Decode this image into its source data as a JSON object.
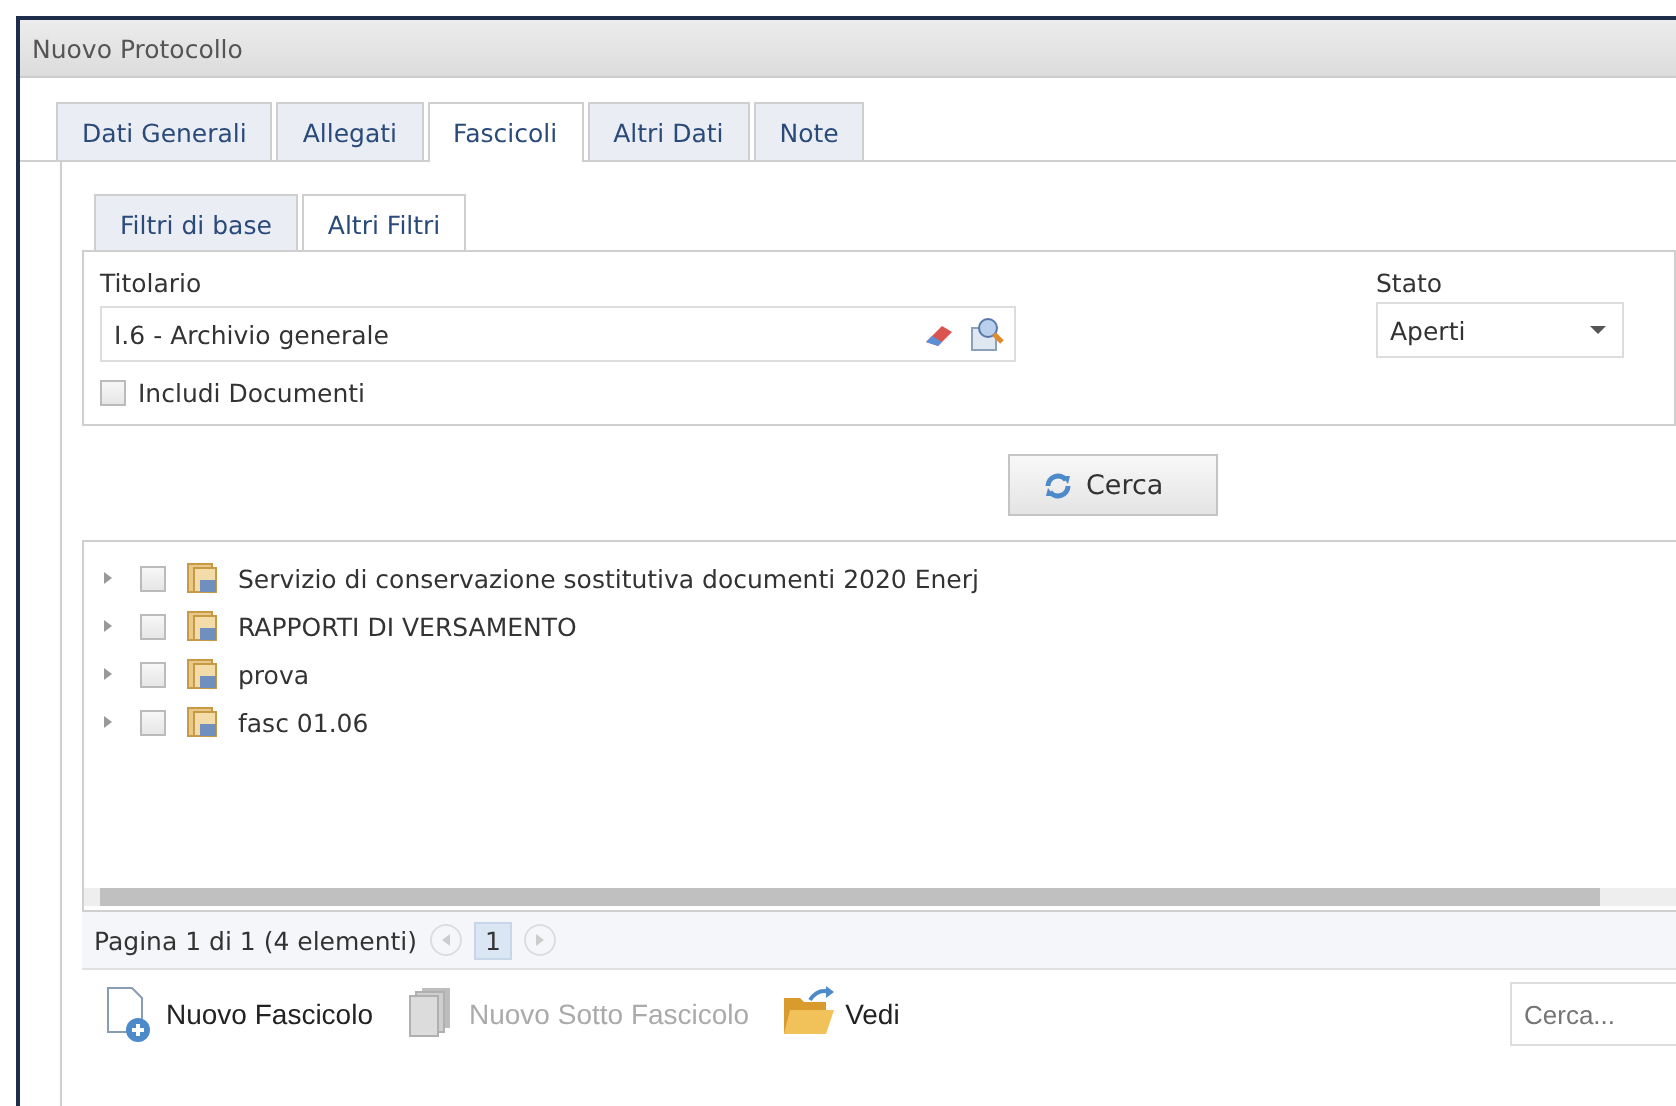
{
  "window": {
    "title": "Nuovo Protocollo"
  },
  "tabs": [
    {
      "label": "Dati Generali",
      "selected": false
    },
    {
      "label": "Allegati",
      "selected": false
    },
    {
      "label": "Fascicoli",
      "selected": true
    },
    {
      "label": "Altri Dati",
      "selected": false
    },
    {
      "label": "Note",
      "selected": false
    }
  ],
  "filter_tabs": [
    {
      "label": "Filtri di base",
      "selected": false
    },
    {
      "label": "Altri Filtri",
      "selected": true
    }
  ],
  "titolario": {
    "label": "Titolario",
    "value": "I.6 - Archivio generale"
  },
  "stato": {
    "label": "Stato",
    "value": "Aperti"
  },
  "include_documents": {
    "label": "Includi Documenti",
    "checked": false
  },
  "search_button": "Cerca",
  "tree": [
    {
      "label": "Servizio di conservazione sostitutiva documenti 2020 Enerj",
      "expanded": false,
      "checked": false
    },
    {
      "label": "RAPPORTI DI VERSAMENTO",
      "expanded": false,
      "checked": false
    },
    {
      "label": "prova",
      "expanded": false,
      "checked": false
    },
    {
      "label": "fasc 01.06",
      "expanded": false,
      "checked": false
    }
  ],
  "pager": {
    "summary": "Pagina 1 di 1 (4 elementi)",
    "pages": [
      {
        "label": "1",
        "selected": true
      }
    ]
  },
  "toolbar": [
    {
      "label": "Nuovo Fascicolo",
      "kind": "new",
      "disabled": false
    },
    {
      "label": "Nuovo Sotto Fascicolo",
      "kind": "stack",
      "disabled": true
    },
    {
      "label": "Vedi",
      "kind": "folder",
      "disabled": false
    }
  ],
  "toolbar_search": {
    "placeholder": "Cerca..."
  }
}
